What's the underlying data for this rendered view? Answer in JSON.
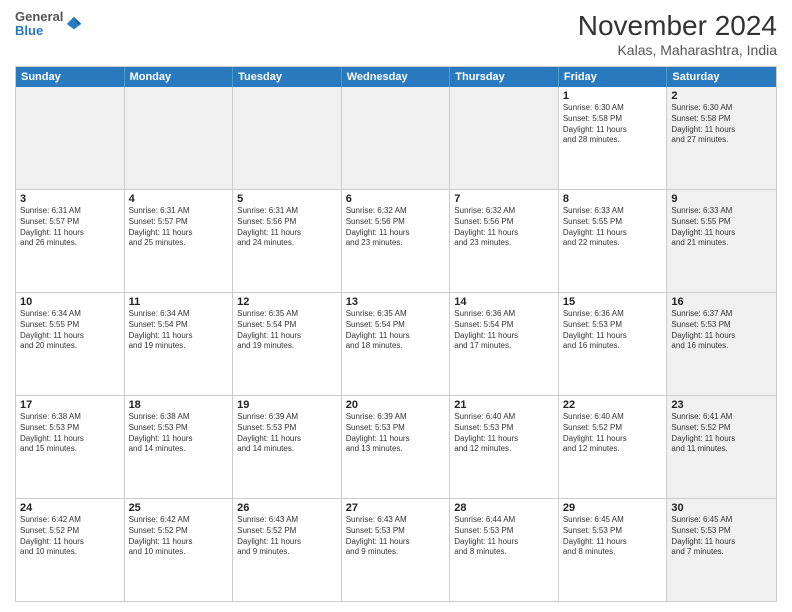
{
  "logo": {
    "line1": "General",
    "line2": "Blue"
  },
  "title": "November 2024",
  "subtitle": "Kalas, Maharashtra, India",
  "header_days": [
    "Sunday",
    "Monday",
    "Tuesday",
    "Wednesday",
    "Thursday",
    "Friday",
    "Saturday"
  ],
  "rows": [
    [
      {
        "day": "",
        "info": "",
        "shaded": true
      },
      {
        "day": "",
        "info": "",
        "shaded": true
      },
      {
        "day": "",
        "info": "",
        "shaded": true
      },
      {
        "day": "",
        "info": "",
        "shaded": true
      },
      {
        "day": "",
        "info": "",
        "shaded": true
      },
      {
        "day": "1",
        "info": "Sunrise: 6:30 AM\nSunset: 5:58 PM\nDaylight: 11 hours\nand 28 minutes.",
        "shaded": false
      },
      {
        "day": "2",
        "info": "Sunrise: 6:30 AM\nSunset: 5:58 PM\nDaylight: 11 hours\nand 27 minutes.",
        "shaded": true
      }
    ],
    [
      {
        "day": "3",
        "info": "Sunrise: 6:31 AM\nSunset: 5:57 PM\nDaylight: 11 hours\nand 26 minutes.",
        "shaded": false
      },
      {
        "day": "4",
        "info": "Sunrise: 6:31 AM\nSunset: 5:57 PM\nDaylight: 11 hours\nand 25 minutes.",
        "shaded": false
      },
      {
        "day": "5",
        "info": "Sunrise: 6:31 AM\nSunset: 5:56 PM\nDaylight: 11 hours\nand 24 minutes.",
        "shaded": false
      },
      {
        "day": "6",
        "info": "Sunrise: 6:32 AM\nSunset: 5:56 PM\nDaylight: 11 hours\nand 23 minutes.",
        "shaded": false
      },
      {
        "day": "7",
        "info": "Sunrise: 6:32 AM\nSunset: 5:56 PM\nDaylight: 11 hours\nand 23 minutes.",
        "shaded": false
      },
      {
        "day": "8",
        "info": "Sunrise: 6:33 AM\nSunset: 5:55 PM\nDaylight: 11 hours\nand 22 minutes.",
        "shaded": false
      },
      {
        "day": "9",
        "info": "Sunrise: 6:33 AM\nSunset: 5:55 PM\nDaylight: 11 hours\nand 21 minutes.",
        "shaded": true
      }
    ],
    [
      {
        "day": "10",
        "info": "Sunrise: 6:34 AM\nSunset: 5:55 PM\nDaylight: 11 hours\nand 20 minutes.",
        "shaded": false
      },
      {
        "day": "11",
        "info": "Sunrise: 6:34 AM\nSunset: 5:54 PM\nDaylight: 11 hours\nand 19 minutes.",
        "shaded": false
      },
      {
        "day": "12",
        "info": "Sunrise: 6:35 AM\nSunset: 5:54 PM\nDaylight: 11 hours\nand 19 minutes.",
        "shaded": false
      },
      {
        "day": "13",
        "info": "Sunrise: 6:35 AM\nSunset: 5:54 PM\nDaylight: 11 hours\nand 18 minutes.",
        "shaded": false
      },
      {
        "day": "14",
        "info": "Sunrise: 6:36 AM\nSunset: 5:54 PM\nDaylight: 11 hours\nand 17 minutes.",
        "shaded": false
      },
      {
        "day": "15",
        "info": "Sunrise: 6:36 AM\nSunset: 5:53 PM\nDaylight: 11 hours\nand 16 minutes.",
        "shaded": false
      },
      {
        "day": "16",
        "info": "Sunrise: 6:37 AM\nSunset: 5:53 PM\nDaylight: 11 hours\nand 16 minutes.",
        "shaded": true
      }
    ],
    [
      {
        "day": "17",
        "info": "Sunrise: 6:38 AM\nSunset: 5:53 PM\nDaylight: 11 hours\nand 15 minutes.",
        "shaded": false
      },
      {
        "day": "18",
        "info": "Sunrise: 6:38 AM\nSunset: 5:53 PM\nDaylight: 11 hours\nand 14 minutes.",
        "shaded": false
      },
      {
        "day": "19",
        "info": "Sunrise: 6:39 AM\nSunset: 5:53 PM\nDaylight: 11 hours\nand 14 minutes.",
        "shaded": false
      },
      {
        "day": "20",
        "info": "Sunrise: 6:39 AM\nSunset: 5:53 PM\nDaylight: 11 hours\nand 13 minutes.",
        "shaded": false
      },
      {
        "day": "21",
        "info": "Sunrise: 6:40 AM\nSunset: 5:53 PM\nDaylight: 11 hours\nand 12 minutes.",
        "shaded": false
      },
      {
        "day": "22",
        "info": "Sunrise: 6:40 AM\nSunset: 5:52 PM\nDaylight: 11 hours\nand 12 minutes.",
        "shaded": false
      },
      {
        "day": "23",
        "info": "Sunrise: 6:41 AM\nSunset: 5:52 PM\nDaylight: 11 hours\nand 11 minutes.",
        "shaded": true
      }
    ],
    [
      {
        "day": "24",
        "info": "Sunrise: 6:42 AM\nSunset: 5:52 PM\nDaylight: 11 hours\nand 10 minutes.",
        "shaded": false
      },
      {
        "day": "25",
        "info": "Sunrise: 6:42 AM\nSunset: 5:52 PM\nDaylight: 11 hours\nand 10 minutes.",
        "shaded": false
      },
      {
        "day": "26",
        "info": "Sunrise: 6:43 AM\nSunset: 5:52 PM\nDaylight: 11 hours\nand 9 minutes.",
        "shaded": false
      },
      {
        "day": "27",
        "info": "Sunrise: 6:43 AM\nSunset: 5:53 PM\nDaylight: 11 hours\nand 9 minutes.",
        "shaded": false
      },
      {
        "day": "28",
        "info": "Sunrise: 6:44 AM\nSunset: 5:53 PM\nDaylight: 11 hours\nand 8 minutes.",
        "shaded": false
      },
      {
        "day": "29",
        "info": "Sunrise: 6:45 AM\nSunset: 5:53 PM\nDaylight: 11 hours\nand 8 minutes.",
        "shaded": false
      },
      {
        "day": "30",
        "info": "Sunrise: 6:45 AM\nSunset: 5:53 PM\nDaylight: 11 hours\nand 7 minutes.",
        "shaded": true
      }
    ]
  ]
}
